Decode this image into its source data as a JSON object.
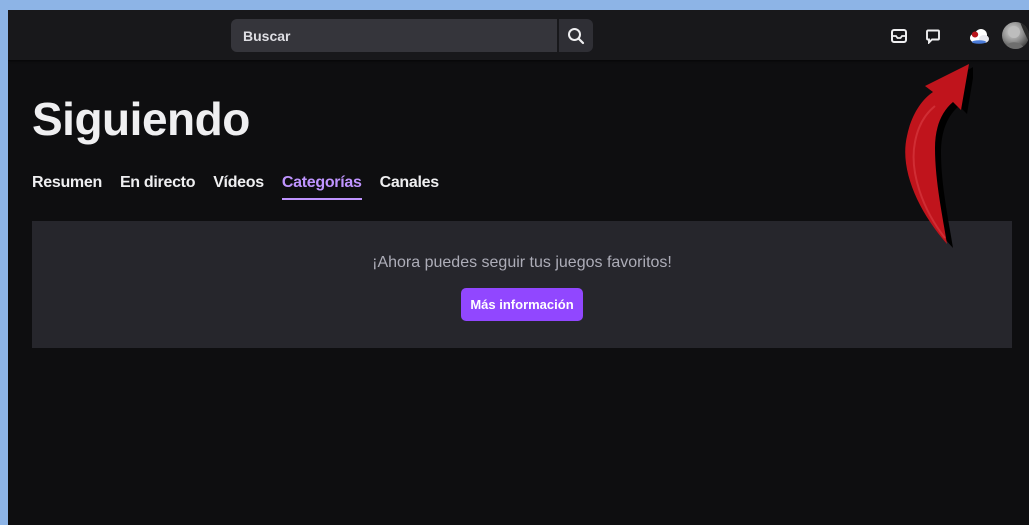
{
  "topbar": {
    "search_placeholder": "Buscar"
  },
  "page": {
    "title": "Siguiendo"
  },
  "tabs": [
    {
      "label": "Resumen",
      "active": false
    },
    {
      "label": "En directo",
      "active": false
    },
    {
      "label": "Vídeos",
      "active": false
    },
    {
      "label": "Categorías",
      "active": true
    },
    {
      "label": "Canales",
      "active": false
    }
  ],
  "banner": {
    "message": "¡Ahora puedes seguir tus juegos favoritos!",
    "button_label": "Más información"
  },
  "colors": {
    "accent": "#bf94ff",
    "button": "#9147ff",
    "annotation_arrow": "#c0141c"
  },
  "icons": [
    "search-icon",
    "inbox-icon",
    "whispers-icon",
    "bits-icon",
    "avatar",
    "annotation-arrow"
  ]
}
